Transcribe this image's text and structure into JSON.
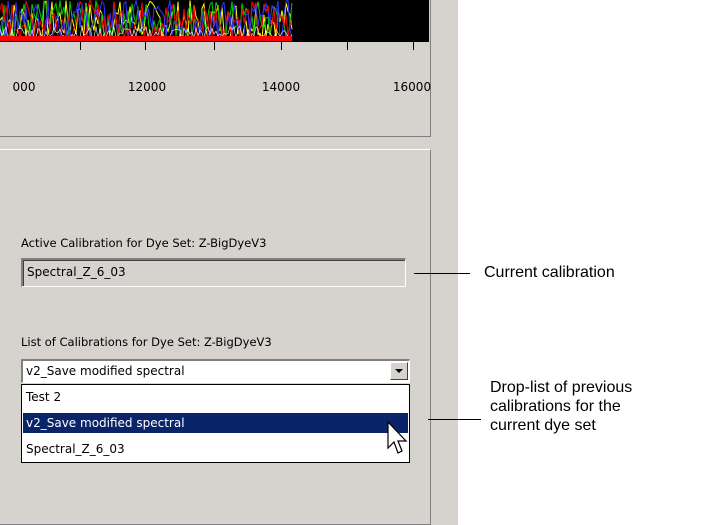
{
  "chart": {
    "x_tick_labels": [
      "000",
      "12000",
      "14000",
      "16000"
    ]
  },
  "panel": {
    "active_label": "Active Calibration for Dye Set: Z-BigDyeV3",
    "active_value": "Spectral_Z_6_03",
    "list_label": "List of Calibrations for Dye Set: Z-BigDyeV3",
    "combo_value": "v2_Save modified spectral",
    "options": [
      "Test 2",
      "v2_Save modified spectral",
      "Spectral_Z_6_03"
    ],
    "selected_option": "v2_Save modified spectral"
  },
  "callouts": {
    "current": "Current calibration",
    "droplist": [
      "Drop-list of previous",
      "calibrations for the",
      "current dye set"
    ]
  },
  "colors": {
    "window_bg": "#d6d3ce",
    "selection": "#0a246a",
    "plot_bg": "#000000"
  }
}
